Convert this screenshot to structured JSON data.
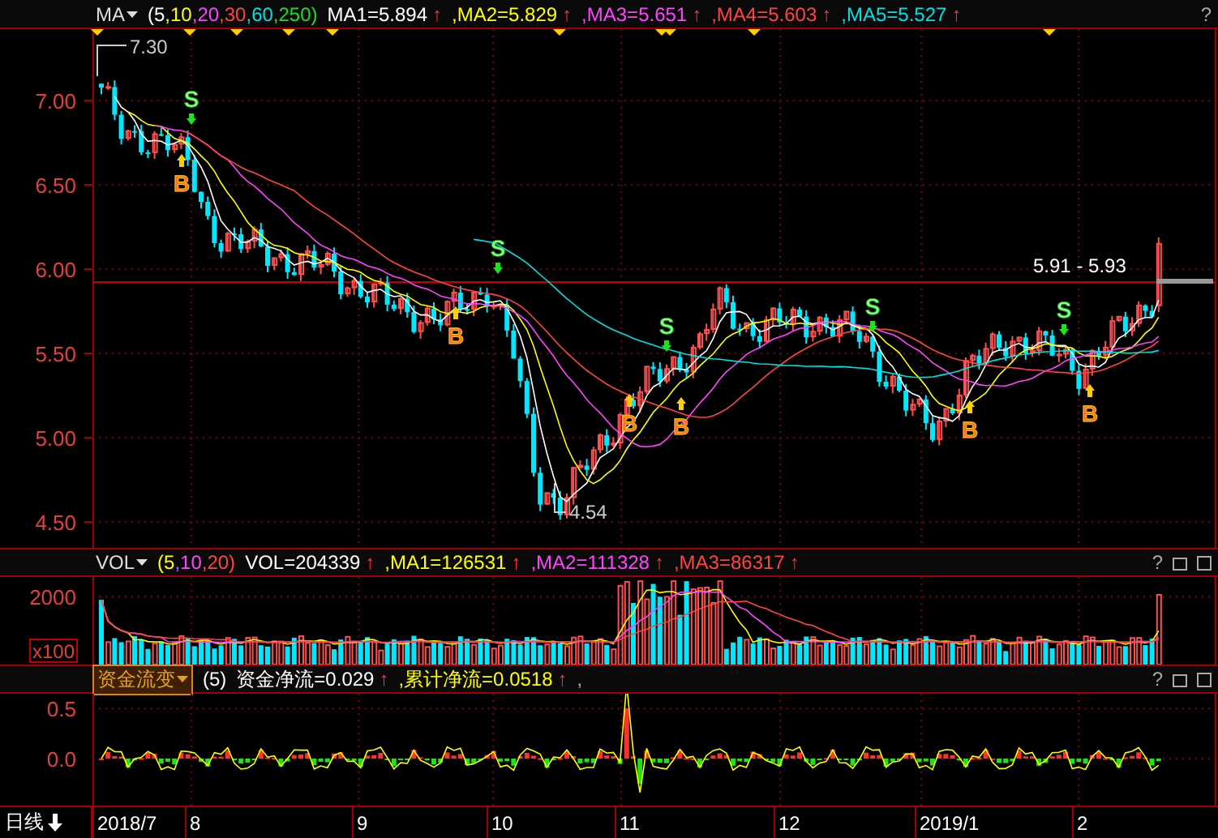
{
  "main_panel": {
    "indicator": "MA",
    "params": [
      {
        "text": "(5",
        "color": "#ffffff"
      },
      {
        "text": ",10",
        "color": "#ffff00"
      },
      {
        "text": ",20",
        "color": "#ff44ff"
      },
      {
        "text": ",30",
        "color": "#ff4444"
      },
      {
        "text": ",60",
        "color": "#00e0e0"
      },
      {
        "text": ",250)",
        "color": "#22dd22"
      }
    ],
    "readings": [
      {
        "text": "MA1=5.894",
        "color": "#ffffff",
        "arrow": "↑"
      },
      {
        "text": ",MA2=5.829",
        "color": "#ffff00",
        "arrow": "↑"
      },
      {
        "text": ",MA3=5.651",
        "color": "#ff44ff",
        "arrow": "↑"
      },
      {
        "text": ",MA4=5.603",
        "color": "#ff4444",
        "arrow": "↑"
      },
      {
        "text": ",MA5=5.527",
        "color": "#00e0e0",
        "arrow": "↑"
      }
    ],
    "help": "?",
    "y_labels": [
      "7.00",
      "6.50",
      "6.00",
      "5.50",
      "5.00",
      "4.50"
    ],
    "high_label": "7.30",
    "low_label": "4.54",
    "price_range": "5.91 - 5.93",
    "signals": [
      {
        "kind": "sell",
        "text": "S"
      },
      {
        "kind": "buy",
        "text": "B"
      },
      {
        "kind": "buy",
        "text": "B"
      },
      {
        "kind": "sell",
        "text": "S"
      },
      {
        "kind": "buy",
        "text": "B"
      },
      {
        "kind": "sell",
        "text": "S"
      },
      {
        "kind": "buy",
        "text": "B"
      },
      {
        "kind": "sell",
        "text": "S"
      },
      {
        "kind": "buy",
        "text": "B"
      },
      {
        "kind": "sell",
        "text": "S"
      },
      {
        "kind": "buy",
        "text": "B"
      }
    ]
  },
  "volume_panel": {
    "indicator": "VOL",
    "params": [
      {
        "text": "(5",
        "color": "#ffff00"
      },
      {
        "text": ",10",
        "color": "#ff44ff"
      },
      {
        "text": ",20)",
        "color": "#ff4444"
      }
    ],
    "readings": [
      {
        "text": "VOL=204339",
        "color": "#ffffff",
        "arrow": "↑"
      },
      {
        "text": ",MA1=126531",
        "color": "#ffff00",
        "arrow": "↑"
      },
      {
        "text": ",MA2=111328",
        "color": "#ff44ff",
        "arrow": "↑"
      },
      {
        "text": ",MA3=86317",
        "color": "#ff4444",
        "arrow": "↑"
      }
    ],
    "help": "?",
    "y_labels": [
      "2000"
    ],
    "unit": "x100"
  },
  "flow_panel": {
    "indicator": "资金流变",
    "params": [
      {
        "text": "(5)",
        "color": "#ffffff"
      }
    ],
    "readings": [
      {
        "text": "资金净流=0.029",
        "color": "#ffffff",
        "arrow": "↑"
      },
      {
        "text": ",累计净流=0.0518",
        "color": "#ffff00",
        "arrow": "↑"
      }
    ],
    "trailing": ",",
    "help": "?",
    "y_labels": [
      "0.5",
      "0.0"
    ]
  },
  "date_axis": {
    "period": "日线",
    "labels": [
      "2018/7",
      "8",
      "9",
      "10",
      "11",
      "12",
      "2019/1",
      "2"
    ]
  }
}
